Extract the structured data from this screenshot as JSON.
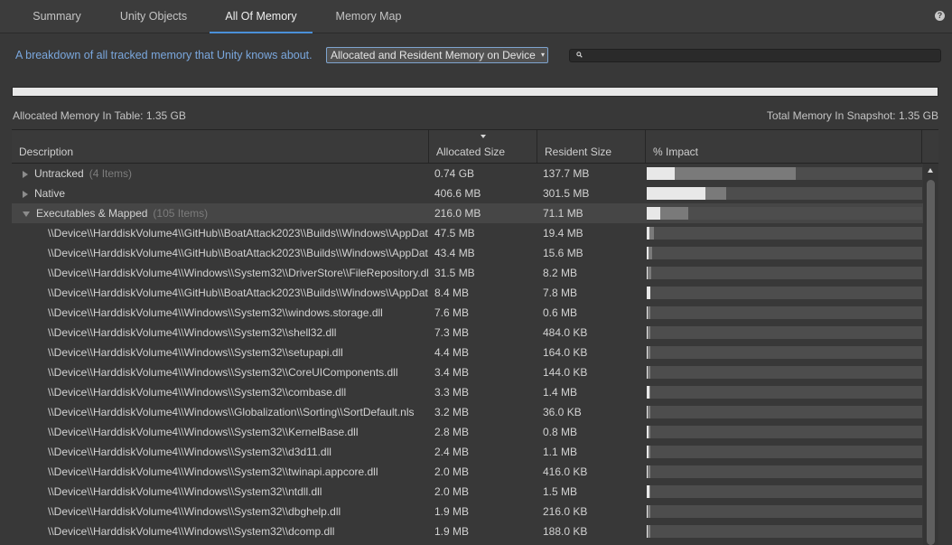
{
  "tabs": [
    {
      "label": "Summary",
      "active": false
    },
    {
      "label": "Unity Objects",
      "active": false
    },
    {
      "label": "All Of Memory",
      "active": true
    },
    {
      "label": "Memory Map",
      "active": false
    }
  ],
  "help_glyph": "?",
  "description": "A breakdown of all tracked memory that Unity knows about.",
  "mode_select": {
    "value": "Allocated and Resident Memory on Device",
    "caret": "▾"
  },
  "search": {
    "value": "",
    "placeholder": ""
  },
  "memory_bar": {
    "fill_fraction": 1.0
  },
  "allocated_in_table": "Allocated Memory In Table: 1.35 GB",
  "total_in_snapshot": "Total Memory In Snapshot: 1.35 GB",
  "colors": {
    "accent": "#4a90d9",
    "link_text": "#7aa7dd",
    "bar_allocated": "#e8e8e8",
    "bar_resident": "#7a7a7a",
    "bar_track": "#4d4d4d"
  },
  "table": {
    "columns": {
      "description": "Description",
      "allocated": "Allocated Size",
      "resident": "Resident Size",
      "impact": "% Impact"
    },
    "sorted_column": "allocated",
    "rows": [
      {
        "level": 0,
        "expanded": false,
        "name": "Untracked",
        "count": "(4 Items)",
        "allocated": "0.74 GB",
        "resident": "137.7 MB",
        "impact_alloc": 0.1,
        "impact_res": 0.54
      },
      {
        "level": 0,
        "expanded": false,
        "name": "Native",
        "count": "",
        "allocated": "406.6 MB",
        "resident": "301.5 MB",
        "impact_alloc": 0.214,
        "impact_res": 0.289
      },
      {
        "level": 0,
        "expanded": true,
        "selected": true,
        "name": "Executables & Mapped",
        "count": "(105 Items)",
        "allocated": "216.0 MB",
        "resident": "71.1 MB",
        "impact_alloc": 0.049,
        "impact_res": 0.15
      },
      {
        "level": 1,
        "name": "\\\\Device\\\\HarddiskVolume4\\\\GitHub\\\\BoatAttack2023\\\\Builds\\\\Windows\\\\AppDataLocal.exe",
        "allocated": "47.5 MB",
        "resident": "19.4 MB",
        "impact_alloc": 0.01,
        "impact_res": 0.026
      },
      {
        "level": 1,
        "name": "\\\\Device\\\\HarddiskVolume4\\\\GitHub\\\\BoatAttack2023\\\\Builds\\\\Windows\\\\AppDataLocal.dll",
        "allocated": "43.4 MB",
        "resident": "15.6 MB",
        "impact_alloc": 0.008,
        "impact_res": 0.021
      },
      {
        "level": 1,
        "name": "\\\\Device\\\\HarddiskVolume4\\\\Windows\\\\System32\\\\DriverStore\\\\FileRepository.dll",
        "allocated": "31.5 MB",
        "resident": "8.2 MB",
        "impact_alloc": 0.004,
        "impact_res": 0.015
      },
      {
        "level": 1,
        "name": "\\\\Device\\\\HarddiskVolume4\\\\GitHub\\\\BoatAttack2023\\\\Builds\\\\Windows\\\\AppDataLocal.pak",
        "allocated": "8.4 MB",
        "resident": "7.8 MB",
        "impact_alloc": 0.012,
        "impact_res": 0.014
      },
      {
        "level": 1,
        "name": "\\\\Device\\\\HarddiskVolume4\\\\Windows\\\\System32\\\\windows.storage.dll",
        "allocated": "7.6 MB",
        "resident": "0.6 MB",
        "impact_alloc": 0.002,
        "impact_res": 0.013
      },
      {
        "level": 1,
        "name": "\\\\Device\\\\HarddiskVolume4\\\\Windows\\\\System32\\\\shell32.dll",
        "allocated": "7.3 MB",
        "resident": "484.0 KB",
        "impact_alloc": 0.002,
        "impact_res": 0.013
      },
      {
        "level": 1,
        "name": "\\\\Device\\\\HarddiskVolume4\\\\Windows\\\\System32\\\\setupapi.dll",
        "allocated": "4.4 MB",
        "resident": "164.0 KB",
        "impact_alloc": 0.001,
        "impact_res": 0.012
      },
      {
        "level": 1,
        "name": "\\\\Device\\\\HarddiskVolume4\\\\Windows\\\\System32\\\\CoreUIComponents.dll",
        "allocated": "3.4 MB",
        "resident": "144.0 KB",
        "impact_alloc": 0.001,
        "impact_res": 0.012
      },
      {
        "level": 1,
        "name": "\\\\Device\\\\HarddiskVolume4\\\\Windows\\\\System32\\\\combase.dll",
        "allocated": "3.3 MB",
        "resident": "1.4 MB",
        "impact_alloc": 0.01,
        "impact_res": 0.012
      },
      {
        "level": 1,
        "name": "\\\\Device\\\\HarddiskVolume4\\\\Windows\\\\Globalization\\\\Sorting\\\\SortDefault.nls",
        "allocated": "3.2 MB",
        "resident": "36.0 KB",
        "impact_alloc": 0.001,
        "impact_res": 0.012
      },
      {
        "level": 1,
        "name": "\\\\Device\\\\HarddiskVolume4\\\\Windows\\\\System32\\\\KernelBase.dll",
        "allocated": "2.8 MB",
        "resident": "0.8 MB",
        "impact_alloc": 0.006,
        "impact_res": 0.012
      },
      {
        "level": 1,
        "name": "\\\\Device\\\\HarddiskVolume4\\\\Windows\\\\System32\\\\d3d11.dll",
        "allocated": "2.4 MB",
        "resident": "1.1 MB",
        "impact_alloc": 0.008,
        "impact_res": 0.012
      },
      {
        "level": 1,
        "name": "\\\\Device\\\\HarddiskVolume4\\\\Windows\\\\System32\\\\twinapi.appcore.dll",
        "allocated": "2.0 MB",
        "resident": "416.0 KB",
        "impact_alloc": 0.003,
        "impact_res": 0.012
      },
      {
        "level": 1,
        "name": "\\\\Device\\\\HarddiskVolume4\\\\Windows\\\\System32\\\\ntdll.dll",
        "allocated": "2.0 MB",
        "resident": "1.5 MB",
        "impact_alloc": 0.011,
        "impact_res": 0.012
      },
      {
        "level": 1,
        "name": "\\\\Device\\\\HarddiskVolume4\\\\Windows\\\\System32\\\\dbghelp.dll",
        "allocated": "1.9 MB",
        "resident": "216.0 KB",
        "impact_alloc": 0.002,
        "impact_res": 0.012
      },
      {
        "level": 1,
        "name": "\\\\Device\\\\HarddiskVolume4\\\\Windows\\\\System32\\\\dcomp.dll",
        "allocated": "1.9 MB",
        "resident": "188.0 KB",
        "impact_alloc": 0.001,
        "impact_res": 0.012
      }
    ]
  }
}
